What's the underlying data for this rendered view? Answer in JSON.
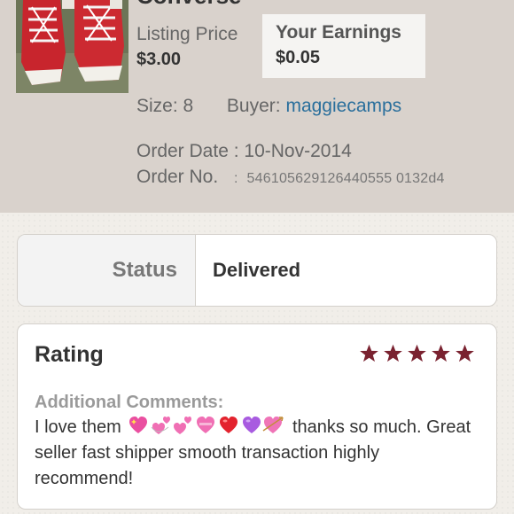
{
  "listing": {
    "title": "Converse",
    "listing_price_label": "Listing Price",
    "listing_price": "$3.00",
    "earnings_label": "Your Earnings",
    "earnings": "$0.05",
    "image_icon": "red-sneakers-photo"
  },
  "details": {
    "size_label": "Size:",
    "size": "8",
    "buyer_label": "Buyer:",
    "buyer": "maggiecamps",
    "order_date_label": "Order Date :",
    "order_date": "10-Nov-2014",
    "order_no_label": "Order No.",
    "order_no_sep": ":",
    "order_no": "546105629126440555 0132d4"
  },
  "status": {
    "label": "Status",
    "value": "Delivered"
  },
  "rating": {
    "title": "Rating",
    "stars": 5,
    "max_stars": 5,
    "star_color": "#7a2230",
    "comments_label": "Additional Comments:",
    "comment_start": "I love them",
    "comment_rest": "thanks so much. Great seller fast shipper smooth transaction highly recommend!",
    "emoji_icons": [
      "sparkling-heart-icon",
      "revolving-hearts-icon",
      "two-hearts-icon",
      "heart-with-ribbon-icon",
      "red-heart-icon",
      "purple-heart-icon",
      "heart-with-arrow-icon"
    ]
  },
  "colors": {
    "header_bg": "#d9d2cc",
    "link": "#2a6f9c"
  }
}
